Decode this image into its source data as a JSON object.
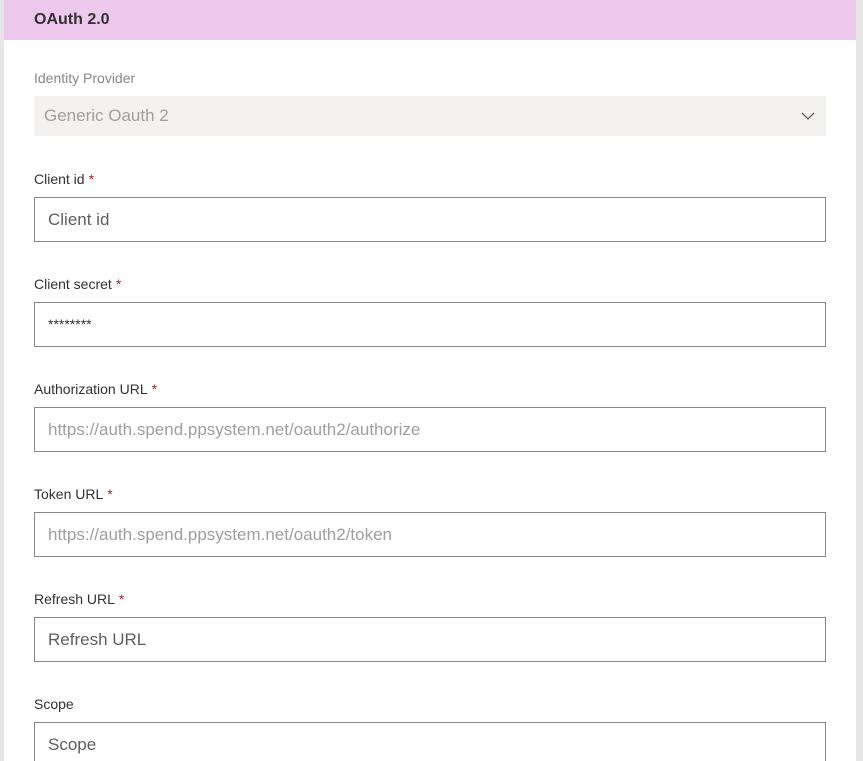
{
  "header": {
    "title": "OAuth 2.0"
  },
  "identity_provider": {
    "label": "Identity Provider",
    "value": "Generic Oauth 2"
  },
  "client_id": {
    "label": "Client id",
    "required_mark": "*",
    "value": "Client id"
  },
  "client_secret": {
    "label": "Client secret",
    "required_mark": "*",
    "value": "********"
  },
  "authorization_url": {
    "label": "Authorization URL",
    "required_mark": "*",
    "placeholder": "https://auth.spend.ppsystem.net/oauth2/authorize"
  },
  "token_url": {
    "label": "Token URL",
    "required_mark": "*",
    "placeholder": "https://auth.spend.ppsystem.net/oauth2/token"
  },
  "refresh_url": {
    "label": "Refresh URL",
    "required_mark": "*",
    "value": "Refresh URL"
  },
  "scope": {
    "label": "Scope",
    "value": "Scope"
  },
  "colors": {
    "header_bg": "#ecc8ec",
    "required": "#a4262c",
    "border": "#8a8886"
  }
}
